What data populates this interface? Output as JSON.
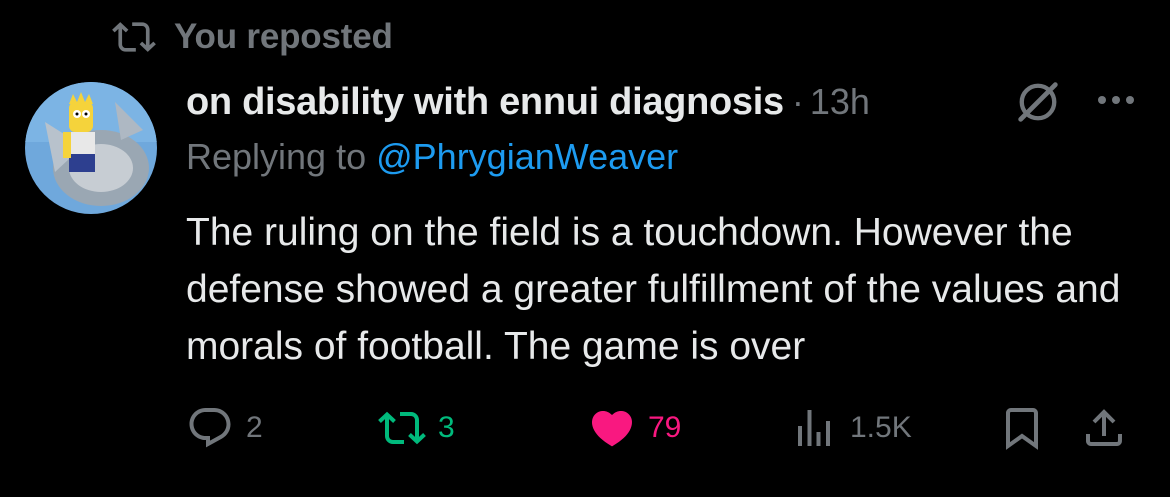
{
  "repost_banner": {
    "icon": "repost-icon",
    "text": "You reposted"
  },
  "post": {
    "avatar": "avatar",
    "display_name": "on disability with ennui diagnosis",
    "separator": "·",
    "time": "13h",
    "replying_prefix": "Replying to ",
    "replying_handle": "@PhrygianWeaver",
    "body": "The ruling on the field is a touchdown. However the defense showed a greater fulfillment of the values and morals of football. The game is over"
  },
  "actions": {
    "reply_count": "2",
    "repost_count": "3",
    "like_count": "79",
    "views_count": "1.5K"
  },
  "colors": {
    "background": "#000000",
    "primary_text": "#e7e9ea",
    "secondary_text": "#71767b",
    "link": "#1d9bf0",
    "repost_active": "#00ba7c",
    "like_active": "#f91880"
  }
}
